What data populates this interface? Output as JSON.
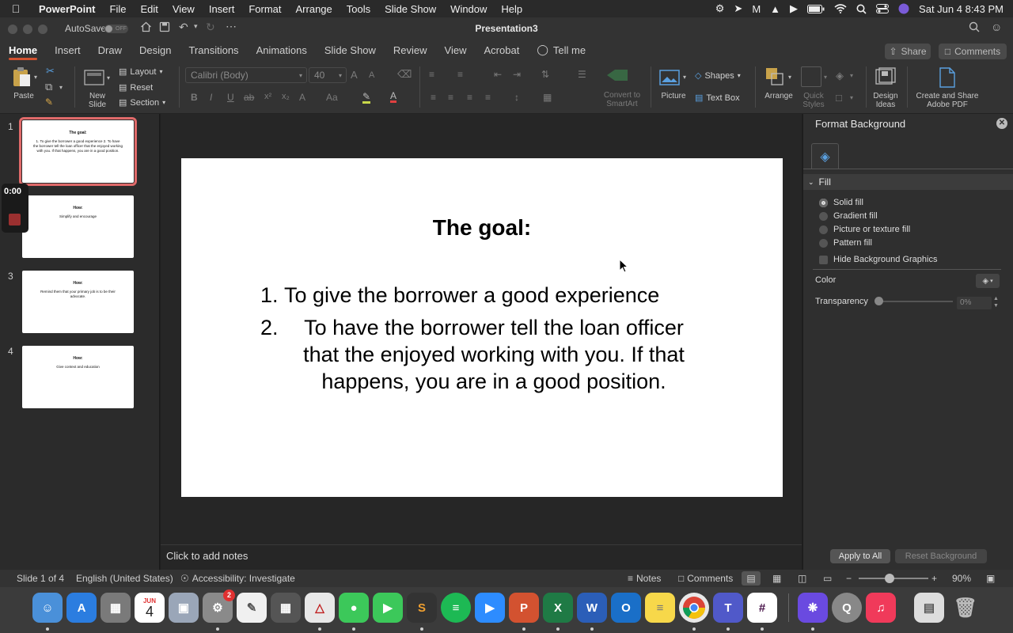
{
  "menubar": {
    "app": "PowerPoint",
    "items": [
      "File",
      "Edit",
      "View",
      "Insert",
      "Format",
      "Arrange",
      "Tools",
      "Slide Show",
      "Window",
      "Help"
    ],
    "datetime": "Sat Jun 4  8:43 PM"
  },
  "titlebar": {
    "autosave": "AutoSave",
    "autosave_state": "OFF",
    "title": "Presentation3"
  },
  "tabs": [
    "Home",
    "Insert",
    "Draw",
    "Design",
    "Transitions",
    "Animations",
    "Slide Show",
    "Review",
    "View",
    "Acrobat"
  ],
  "tell_me": "Tell me",
  "share": "Share",
  "comments_btn": "Comments",
  "ribbon": {
    "paste": "Paste",
    "new_slide": [
      "New",
      "Slide"
    ],
    "layout": "Layout",
    "reset": "Reset",
    "section": "Section",
    "font": "Calibri (Body)",
    "size": "40",
    "convert": [
      "Convert to",
      "SmartArt"
    ],
    "picture": "Picture",
    "shapes": "Shapes",
    "textbox": "Text Box",
    "arrange": "Arrange",
    "quick_styles": [
      "Quick",
      "Styles"
    ],
    "design_ideas": [
      "Design",
      "Ideas"
    ],
    "create_share": [
      "Create and Share",
      "Adobe PDF"
    ]
  },
  "slides": [
    {
      "num": "1",
      "title": "The goal:",
      "body": "1. To give the borrower a good experience 2. To have the borrower tell the loan officer that the enjoyed working with you. If that happens, you are in a good position."
    },
    {
      "num": "2",
      "title": "How:",
      "body": "Simplify and encourage"
    },
    {
      "num": "3",
      "title": "How:",
      "body": "Remind them that your primary job is to be their advocate."
    },
    {
      "num": "4",
      "title": "How:",
      "body": "Give context and education"
    }
  ],
  "recording_time": "0:00",
  "main_slide": {
    "title": "The goal:",
    "items": [
      {
        "n": "1.",
        "text": "To give the borrower a good experience"
      },
      {
        "n": "2.",
        "text": "To have the borrower tell the loan officer that the enjoyed working with you. If that happens, you are in a good position."
      }
    ]
  },
  "notes_placeholder": "Click to add notes",
  "format_pane": {
    "title": "Format Background",
    "section": "Fill",
    "options": [
      "Solid fill",
      "Gradient fill",
      "Picture or texture fill",
      "Pattern fill"
    ],
    "selected": 0,
    "hide_graphics": "Hide Background Graphics",
    "color_label": "Color",
    "transparency_label": "Transparency",
    "transparency_value": "0%",
    "apply_all": "Apply to All",
    "reset_bg": "Reset Background"
  },
  "status": {
    "slide": "Slide 1 of 4",
    "language": "English (United States)",
    "accessibility": "Accessibility: Investigate",
    "notes": "Notes",
    "comments": "Comments",
    "zoom": "90%"
  },
  "dock": {
    "calendar_month": "JUN",
    "calendar_day": "4",
    "settings_badge": "2"
  }
}
